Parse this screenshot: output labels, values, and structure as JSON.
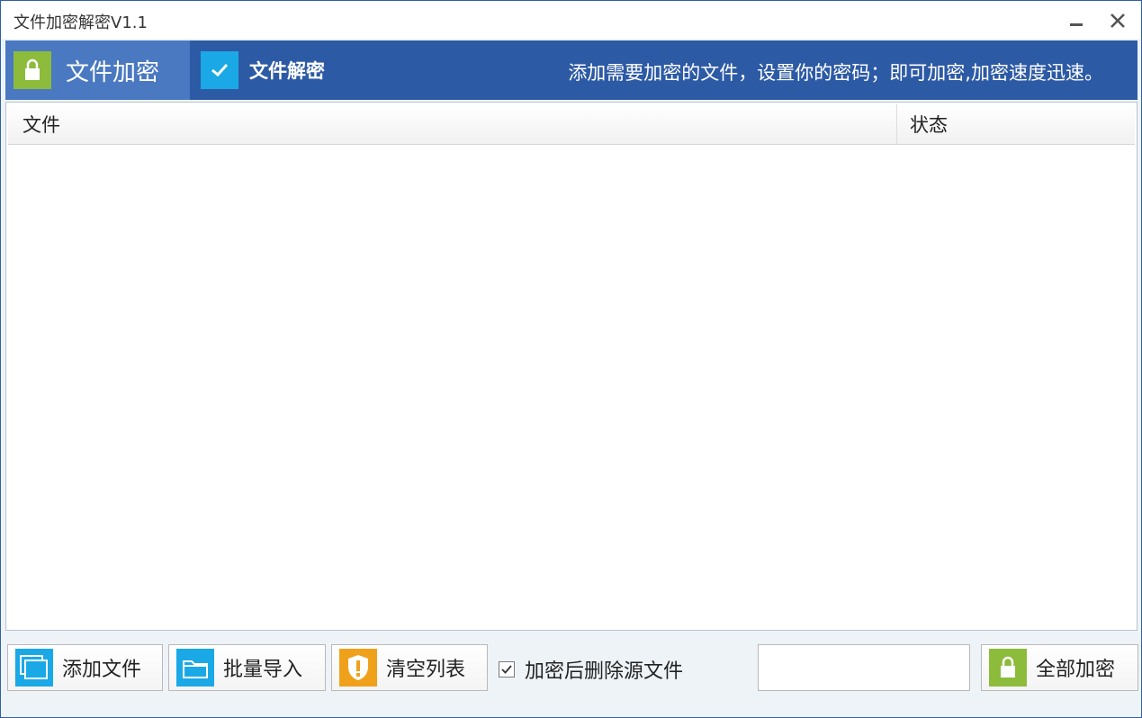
{
  "window": {
    "title": "文件加密解密V1.1"
  },
  "tabs": {
    "encrypt": {
      "label": "文件加密",
      "icon": "lock-icon"
    },
    "decrypt": {
      "label": "文件解密",
      "icon": "check-icon"
    }
  },
  "hint": "添加需要加密的文件，设置你的密码；即可加密,加密速度迅速。",
  "table": {
    "columns": [
      "文件",
      "状态"
    ],
    "rows": []
  },
  "actions": {
    "add_file": "添加文件",
    "batch_import": "批量导入",
    "clear_list": "清空列表",
    "delete_after": "加密后删除源文件",
    "delete_after_checked": true,
    "password_value": "",
    "encrypt_all": "全部加密"
  },
  "colors": {
    "titlebar_blue": "#2d5aa5",
    "tab_active": "#4a79c2",
    "lock_green": "#8dbb3c",
    "folder_blue": "#1aa9e6",
    "shield_orange": "#f0a11c"
  }
}
